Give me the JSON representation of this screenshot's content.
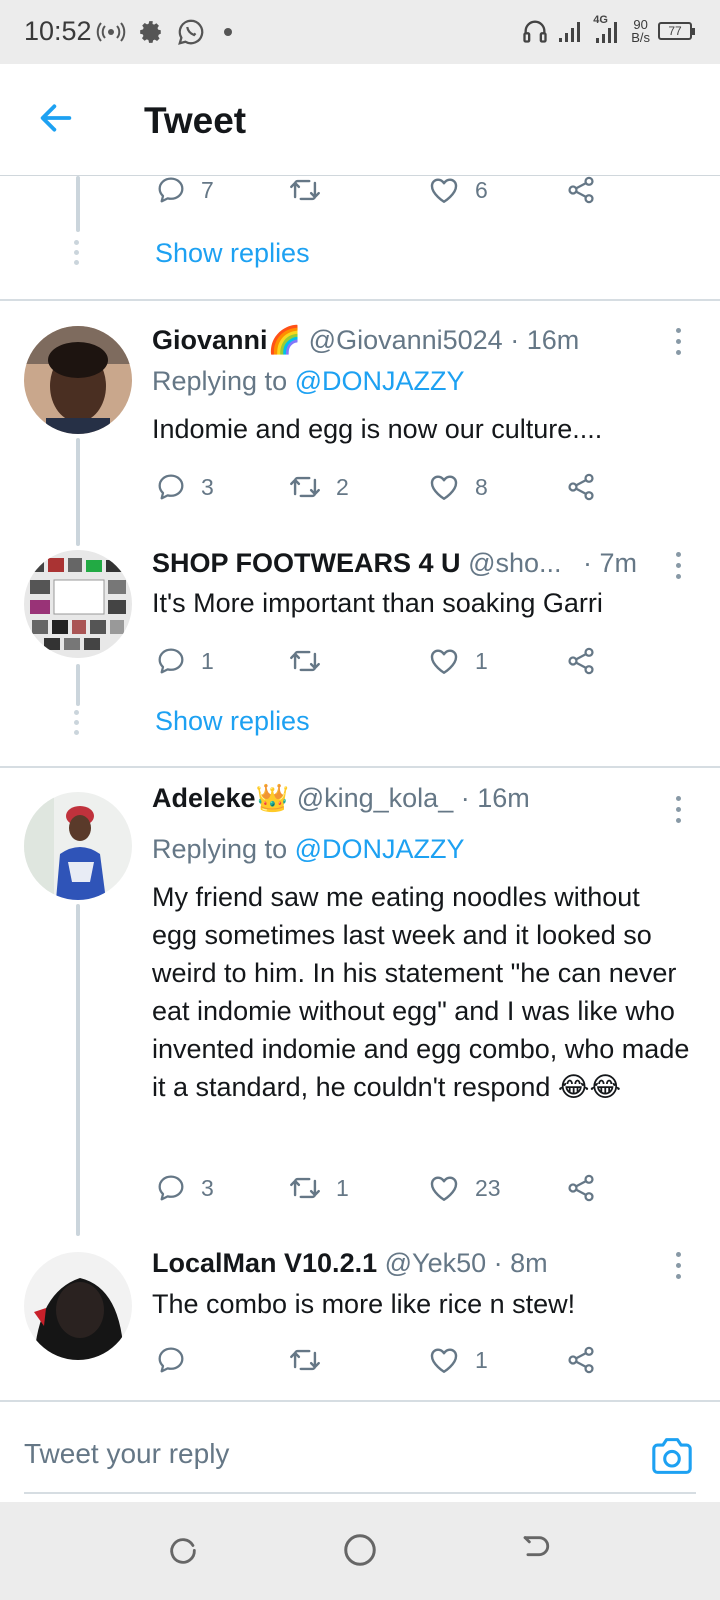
{
  "status_bar": {
    "time": "10:52",
    "network": "4G",
    "net_speed_value": "90",
    "net_speed_unit": "B/s",
    "battery": "77"
  },
  "header": {
    "title": "Tweet"
  },
  "top_stub": {
    "reply_count": "7",
    "retweet_count": "",
    "like_count": "6",
    "show_replies": "Show replies"
  },
  "tweets": [
    {
      "name": "Giovanni🌈",
      "handle": "@Giovanni5024",
      "time": "· 16m",
      "replying_label": "Replying to",
      "replying_handle": "@DONJAZZY",
      "text": "Indomie and egg is now our culture....",
      "replies": "3",
      "retweets": "2",
      "likes": "8"
    },
    {
      "name": "SHOP FOOTWEARS 4 U",
      "handle": "@sho...",
      "time": "· 7m",
      "text": "It's More important than soaking Garri",
      "replies": "1",
      "retweets": "",
      "likes": "1",
      "show_replies": "Show replies"
    },
    {
      "name": "Adeleke👑",
      "handle": "@king_kola_",
      "time": "· 16m",
      "replying_label": "Replying to",
      "replying_handle": "@DONJAZZY",
      "text": "My friend saw me eating noodles without egg sometimes last week and it looked so weird to him. In his statement \"he can never eat indomie without egg\" and I was like who invented indomie and egg combo, who made it a standard, he couldn't respond 😂😂",
      "replies": "3",
      "retweets": "1",
      "likes": "23"
    },
    {
      "name": "LocalMan V10.2.1",
      "handle": "@Yek50",
      "time": "· 8m",
      "text": "The combo is more like rice n stew!",
      "replies": "",
      "retweets": "",
      "likes": "1"
    }
  ],
  "composer": {
    "placeholder": "Tweet your reply"
  },
  "colors": {
    "accent": "#1da1f2",
    "muted": "#657786",
    "text": "#14171a"
  },
  "icons": [
    "back-arrow-icon",
    "reply-icon",
    "retweet-icon",
    "like-icon",
    "share-icon",
    "camera-icon",
    "more-icon"
  ]
}
